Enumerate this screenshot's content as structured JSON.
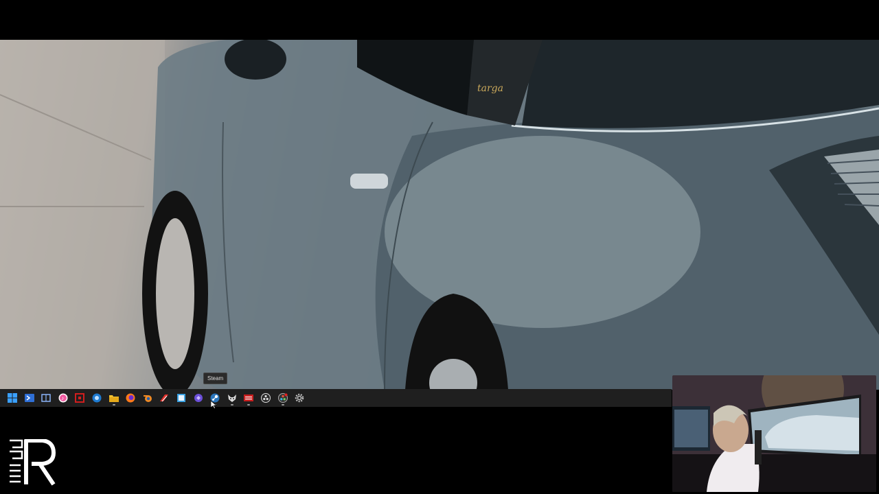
{
  "wallpaper": {
    "subject": "car-photo",
    "badge_text": "targa"
  },
  "taskbar": {
    "tooltip": "Steam",
    "icons": [
      {
        "name": "start-windows-icon",
        "color": "#3aa0ff"
      },
      {
        "name": "powershell-icon",
        "color": "#2f6fd6"
      },
      {
        "name": "task-view-icon",
        "color": "#8ab4f8"
      },
      {
        "name": "itunes-icon",
        "color": "#f05aa0"
      },
      {
        "name": "red-app-icon",
        "color": "#d01e1e"
      },
      {
        "name": "blue-app-icon",
        "color": "#1e7ad0"
      },
      {
        "name": "file-explorer-icon",
        "color": "#f2c230"
      },
      {
        "name": "firefox-icon",
        "color": "#ff7a1a"
      },
      {
        "name": "blender-icon",
        "color": "#f08a24"
      },
      {
        "name": "red-brush-icon",
        "color": "#e0312b"
      },
      {
        "name": "window-app-icon",
        "color": "#39a0e0"
      },
      {
        "name": "purple-app-icon",
        "color": "#6b4fd8"
      },
      {
        "name": "steam-icon",
        "color": "#2a75bb"
      },
      {
        "name": "fox-app-icon",
        "color": "#dddddd"
      },
      {
        "name": "video-app-icon",
        "color": "#c82020"
      },
      {
        "name": "obs-icon",
        "color": "#dddddd"
      },
      {
        "name": "davinci-resolve-icon",
        "color": "#cc3333"
      },
      {
        "name": "settings-gear-icon",
        "color": "#bbbbbb"
      }
    ]
  },
  "overlay": {
    "webcam": "webcam-feed",
    "logo": "channel-logo"
  }
}
